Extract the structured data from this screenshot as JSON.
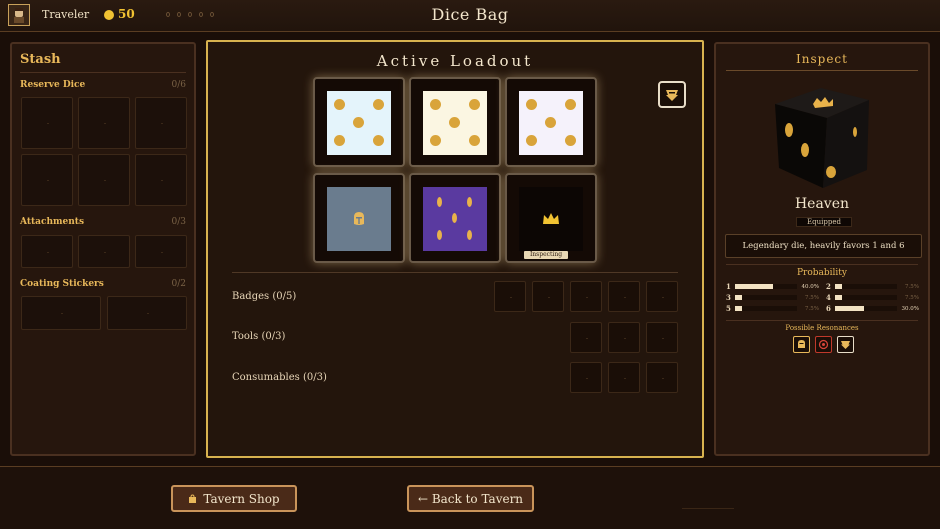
{
  "topbar": {
    "player_name": "Traveler",
    "coins": "50",
    "title": "Dice Bag"
  },
  "stash": {
    "title": "Stash",
    "reserve_label": "Reserve Dice",
    "reserve_count": "0/6",
    "attachments_label": "Attachments",
    "attachments_count": "0/3",
    "coating_label": "Coating Stickers",
    "coating_count": "0/2"
  },
  "loadout": {
    "title": "Active Loadout",
    "dice": [
      {
        "face_color": "#e4f4fb",
        "pips": 5,
        "icon": "five-pips"
      },
      {
        "face_color": "#fbf6e2",
        "pips": 5,
        "icon": "five-pips"
      },
      {
        "face_color": "#f5f2fb",
        "pips": 5,
        "icon": "five-pips"
      },
      {
        "face_color": "#6a7c8e",
        "icon": "knight-helmet-icon"
      },
      {
        "face_color": "#5a3aa0",
        "icon": "droplets-icon"
      },
      {
        "face_color": "#0c0604",
        "icon": "crown-icon",
        "badge": "Inspecting"
      }
    ],
    "badges_label": "Badges (0/5)",
    "tools_label": "Tools (0/3)",
    "consumables_label": "Consumables (0/3)"
  },
  "inspect": {
    "title": "Inspect",
    "die_name": "Heaven",
    "status": "Equipped",
    "description": "Legendary die, heavily favors 1 and 6",
    "probability_title": "Probability",
    "probabilities": [
      {
        "face": "1",
        "value": 40.0,
        "label": "40.0%"
      },
      {
        "face": "2",
        "value": 7.5,
        "label": "7.5%"
      },
      {
        "face": "3",
        "value": 7.5,
        "label": "7.5%"
      },
      {
        "face": "4",
        "value": 7.5,
        "label": "7.5%"
      },
      {
        "face": "5",
        "value": 7.5,
        "label": "7.5%"
      },
      {
        "face": "6",
        "value": 30.0,
        "label": "30.0%"
      }
    ],
    "resonances_title": "Possible Resonances",
    "resonances": [
      "helmet-icon",
      "heart-icon",
      "emblem-icon"
    ]
  },
  "buttons": {
    "shop": "Tavern Shop",
    "back": "← Back to Tavern"
  },
  "colors": {
    "gold": "#e8b85a",
    "accent_border": "#d7b24f",
    "pip": "#d9a43a"
  }
}
